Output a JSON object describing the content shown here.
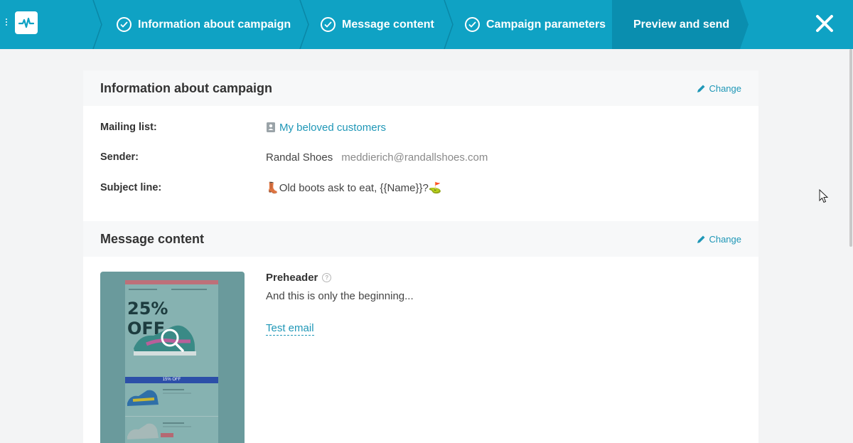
{
  "wizard": {
    "steps": [
      {
        "label": "Information about campaign",
        "done": true
      },
      {
        "label": "Message content",
        "done": true
      },
      {
        "label": "Campaign parameters",
        "done": true
      },
      {
        "label": "Preview and send",
        "done": false
      }
    ],
    "close_icon": "close-icon",
    "colors": {
      "bar": "#0fa2c4",
      "active_step": "#0a8eaf"
    }
  },
  "info_card": {
    "title": "Information about campaign",
    "change_label": "Change",
    "rows": {
      "mailing_list": {
        "label": "Mailing list:",
        "value": "My beloved customers"
      },
      "sender": {
        "label": "Sender:",
        "name": "Randal Shoes",
        "email": "meddierich@randallshoes.com"
      },
      "subject": {
        "label": "Subject line:",
        "prefix_emoji": "👢",
        "text": "Old boots ask to eat, {{Name}}?",
        "suffix_emoji": "⛳"
      }
    }
  },
  "message_card": {
    "title": "Message content",
    "change_label": "Change",
    "preview": {
      "headline_line1": "25%",
      "headline_line2": "OFF",
      "band_text": "15% OFF"
    },
    "preheader_label": "Preheader",
    "preheader_value": "And this is only the beginning...",
    "test_email_label": "Test email"
  },
  "link_color": "#1f97b7"
}
